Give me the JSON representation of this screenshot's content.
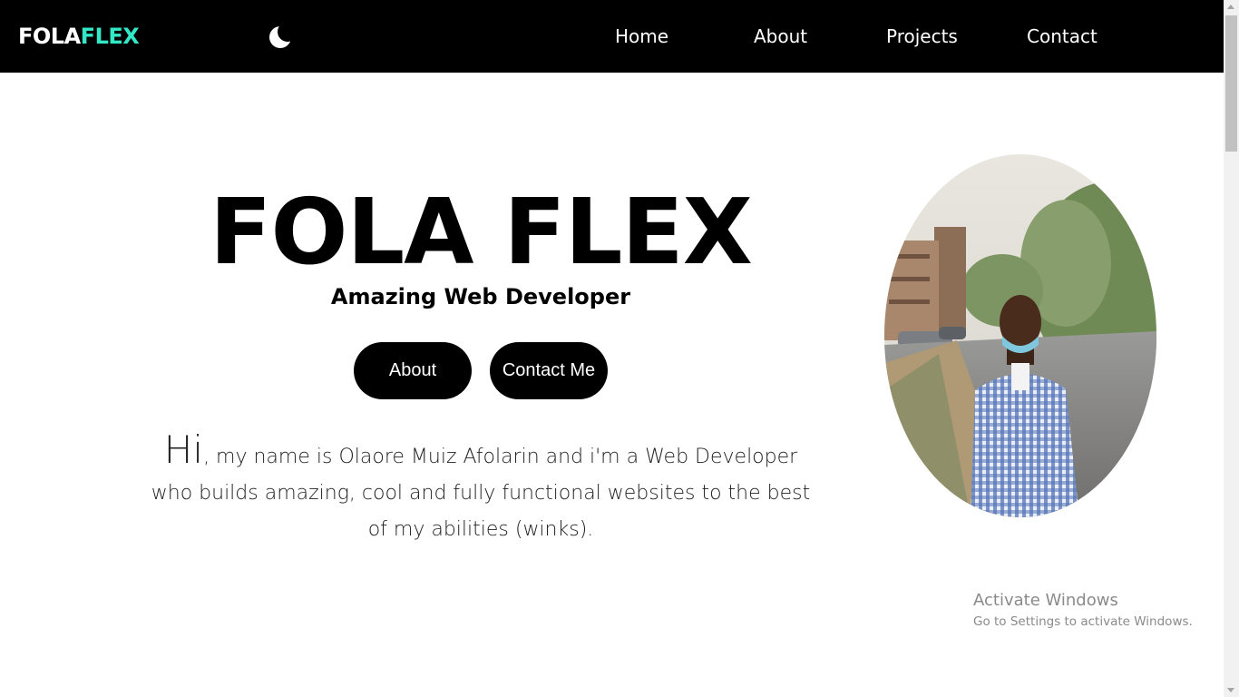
{
  "navbar": {
    "logo_primary": "FOLA",
    "logo_accent": "FLEX",
    "theme_toggle_icon": "moon-icon",
    "links": [
      {
        "label": "Home"
      },
      {
        "label": "About"
      },
      {
        "label": "Projects"
      },
      {
        "label": "Contact"
      }
    ]
  },
  "hero": {
    "title": "FOLA FLEX",
    "subtitle": "Amazing Web Developer",
    "buttons": {
      "about_label": "About",
      "contact_label": "Contact Me"
    },
    "intro_greeting": "Hi",
    "intro_text": ", my name is Olaore Muiz Afolarin and i'm a Web Developer who builds amazing, cool and fully functional websites to the best of my abilities (winks)."
  },
  "photo": {
    "icon": "profile-photo"
  },
  "watermark": {
    "title": "Activate Windows",
    "subtitle": "Go to Settings to activate Windows."
  },
  "colors": {
    "navbar_bg": "#000000",
    "accent": "#33e8c7",
    "button_bg": "#000000",
    "page_bg": "#ffffff"
  }
}
